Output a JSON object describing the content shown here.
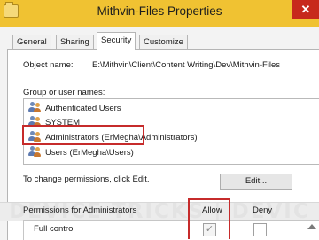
{
  "window": {
    "title": "Mithvin-Files Properties",
    "close_glyph": "✕"
  },
  "tabs": [
    {
      "label": "General",
      "active": false
    },
    {
      "label": "Sharing",
      "active": false
    },
    {
      "label": "Security",
      "active": true
    },
    {
      "label": "Customize",
      "active": false
    }
  ],
  "security": {
    "object_name_label": "Object name:",
    "object_name_value": "E:\\Mithvin\\Client\\Content Writing\\Dev\\Mithvin-Files",
    "group_label": "Group or user names:",
    "users": [
      {
        "name": "Authenticated Users",
        "icon": "users-group-icon"
      },
      {
        "name": "SYSTEM",
        "icon": "users-group-icon"
      },
      {
        "name": "Administrators (ErMegha\\Administrators)",
        "icon": "users-group-icon",
        "highlighted": true
      },
      {
        "name": "Users (ErMegha\\Users)",
        "icon": "users-group-icon"
      }
    ],
    "change_text": "To change permissions, click Edit.",
    "edit_button": "Edit...",
    "permissions_label": "Permissions for Administrators",
    "allow_label": "Allow",
    "deny_label": "Deny",
    "permissions": [
      {
        "name": "Full control",
        "allow": true,
        "deny": false
      }
    ]
  },
  "watermark": "DEVICE TRICKS | DEVIC",
  "colors": {
    "titlebar": "#f0c232",
    "close_button": "#c7291c",
    "highlight": "#c62b2b"
  }
}
